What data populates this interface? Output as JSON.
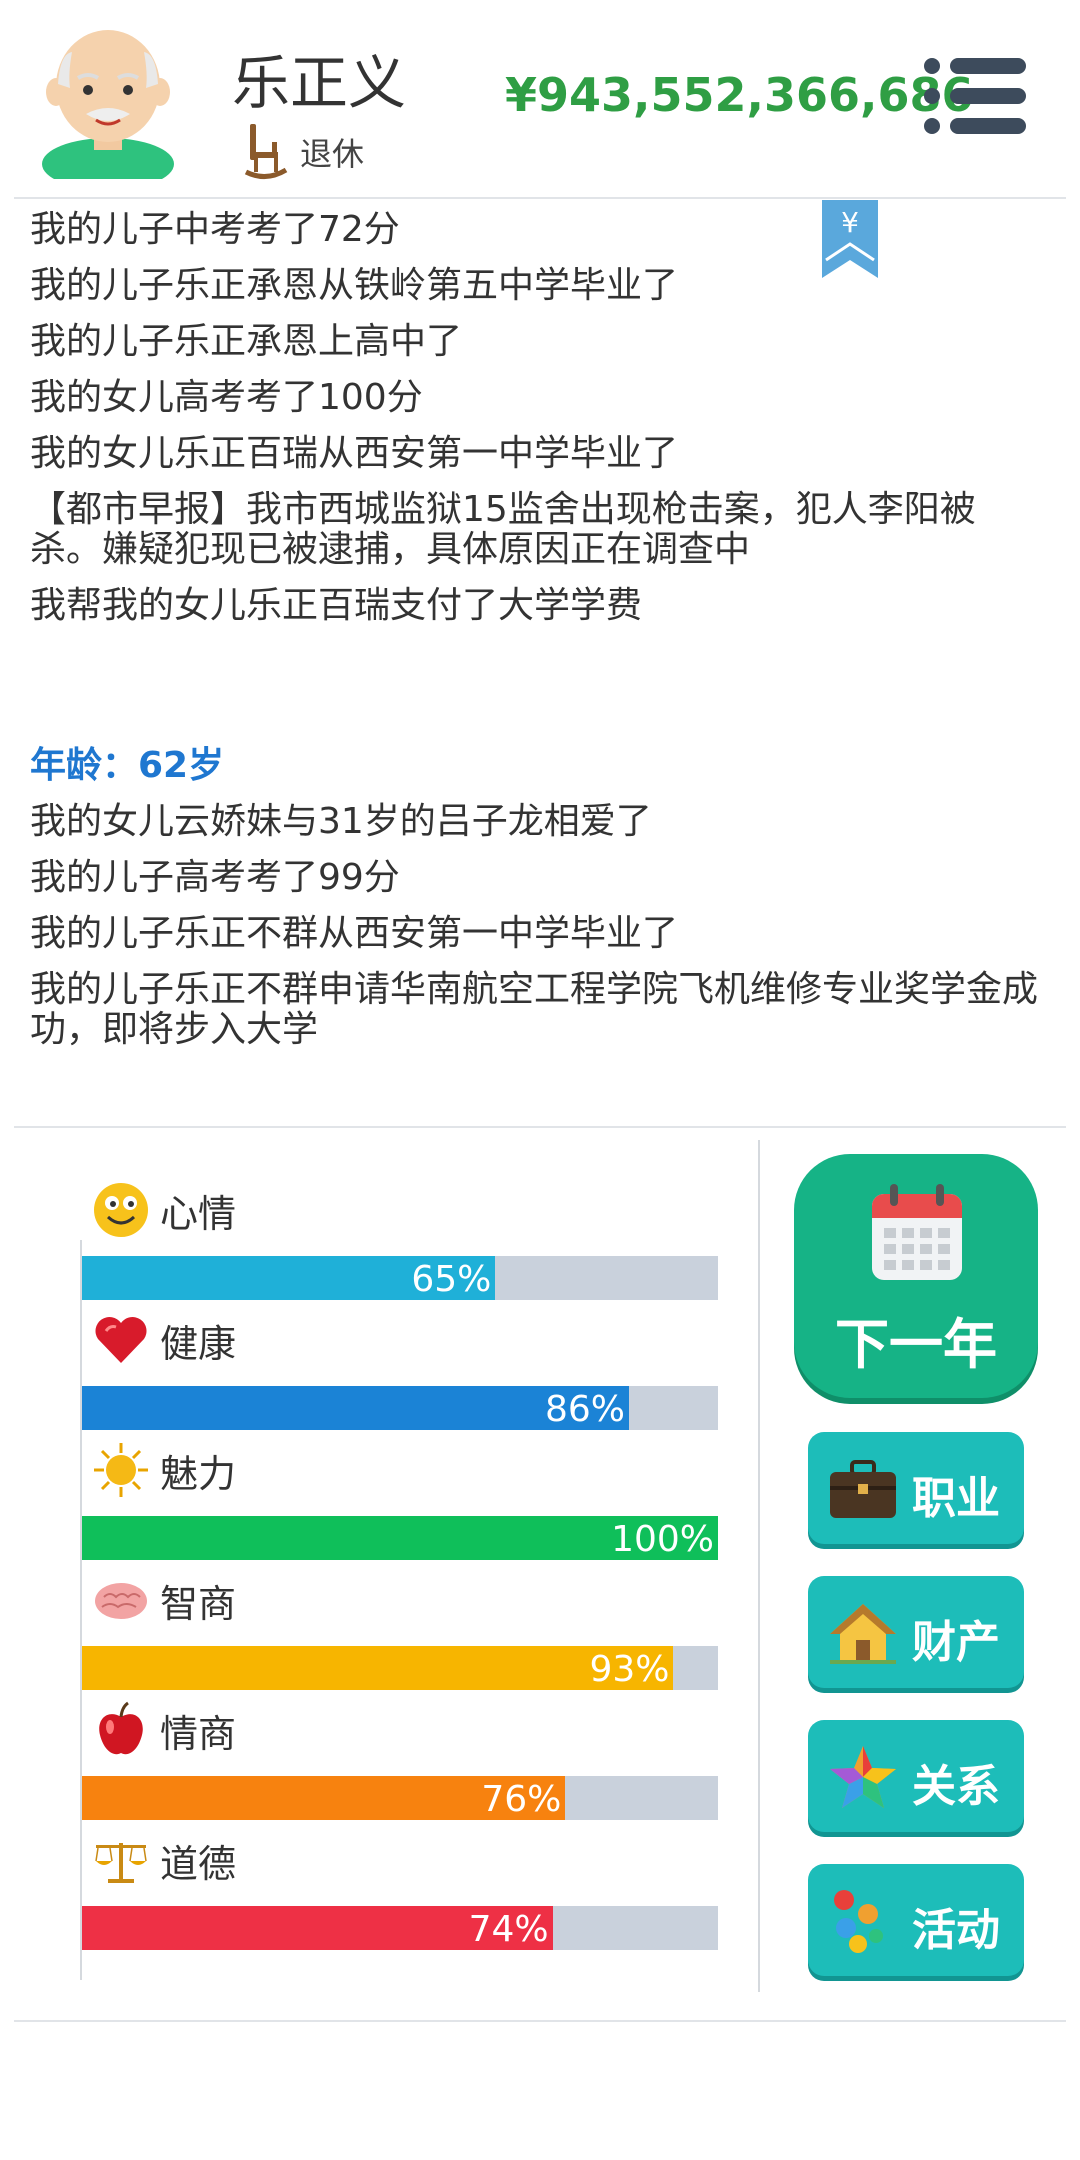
{
  "header": {
    "name": "乐正义",
    "status": "退休",
    "money": "¥943,552,366,686"
  },
  "log": {
    "lines_before": [
      "我的儿子中考考了72分",
      "我的儿子乐正承恩从铁岭第五中学毕业了",
      "我的儿子乐正承恩上高中了",
      "我的女儿高考考了100分",
      "我的女儿乐正百瑞从西安第一中学毕业了",
      "【都市早报】我市西城监狱15监舍出现枪击案，犯人李阳被杀。嫌疑犯现已被逮捕，具体原因正在调查中",
      "我帮我的女儿乐正百瑞支付了大学学费"
    ],
    "age_line": "年龄：62岁",
    "lines_after": [
      "我的女儿云娇妹与31岁的吕子龙相爱了",
      "我的儿子高考考了99分",
      "我的儿子乐正不群从西安第一中学毕业了",
      "我的儿子乐正不群申请华南航空工程学院飞机维修专业奖学金成功，即将步入大学"
    ]
  },
  "stats": [
    {
      "label": "心情",
      "percent": 65,
      "text": "65%",
      "color": "#1fb0d8",
      "icon": "smiley-icon"
    },
    {
      "label": "健康",
      "percent": 86,
      "text": "86%",
      "color": "#1b83d6",
      "icon": "heart-icon"
    },
    {
      "label": "魅力",
      "percent": 100,
      "text": "100%",
      "color": "#0fbf5a",
      "icon": "sun-icon"
    },
    {
      "label": "智商",
      "percent": 93,
      "text": "93%",
      "color": "#f7b500",
      "icon": "brain-icon"
    },
    {
      "label": "情商",
      "percent": 76,
      "text": "76%",
      "color": "#f7820f",
      "icon": "apple-icon"
    },
    {
      "label": "道德",
      "percent": 74,
      "text": "74%",
      "color": "#ee3045",
      "icon": "scale-icon"
    }
  ],
  "buttons": {
    "next_year": "下一年",
    "career": "职业",
    "property": "财产",
    "relations": "关系",
    "activity": "活动"
  },
  "colors": {
    "money": "#2f9e44",
    "age": "#1f77d0",
    "next_button": "#16b386",
    "side_button": "#1dbdb9"
  }
}
